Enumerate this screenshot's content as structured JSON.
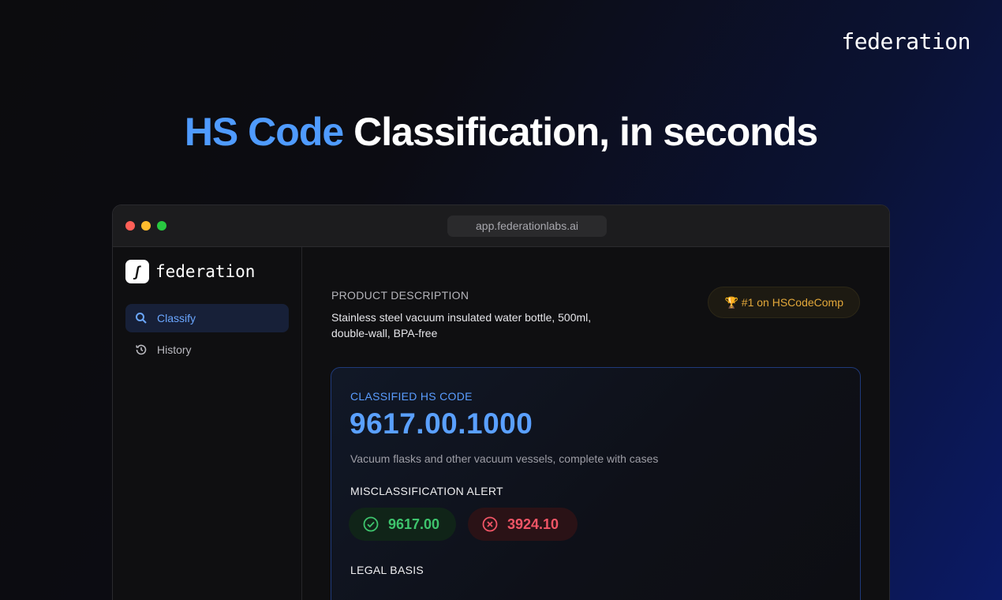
{
  "brand": "federation",
  "hero": {
    "accent": "HS Code",
    "rest": " Classification, in seconds"
  },
  "browser": {
    "url": "app.federationlabs.ai"
  },
  "sidebar": {
    "logo_mark": "ʃ",
    "logo_name": "federation",
    "items": [
      {
        "label": "Classify",
        "icon": "search-icon",
        "active": true
      },
      {
        "label": "History",
        "icon": "history-icon",
        "active": false
      }
    ]
  },
  "main": {
    "product_label": "PRODUCT DESCRIPTION",
    "product_text": "Stainless steel vacuum insulated water bottle, 500ml, double-wall, BPA-free",
    "badge": "🏆 #1 on HSCodeComp",
    "result": {
      "label": "CLASSIFIED HS CODE",
      "code": "9617.00.1000",
      "description": "Vacuum flasks and other vacuum vessels, complete with cases",
      "alert_label": "MISCLASSIFICATION ALERT",
      "correct_code": "9617.00",
      "wrong_code": "3924.10",
      "legal_label": "LEGAL BASIS"
    }
  },
  "colors": {
    "accent": "#4f9bff",
    "success": "#3ec46d",
    "error": "#f05566",
    "badge": "#e3a83a"
  }
}
